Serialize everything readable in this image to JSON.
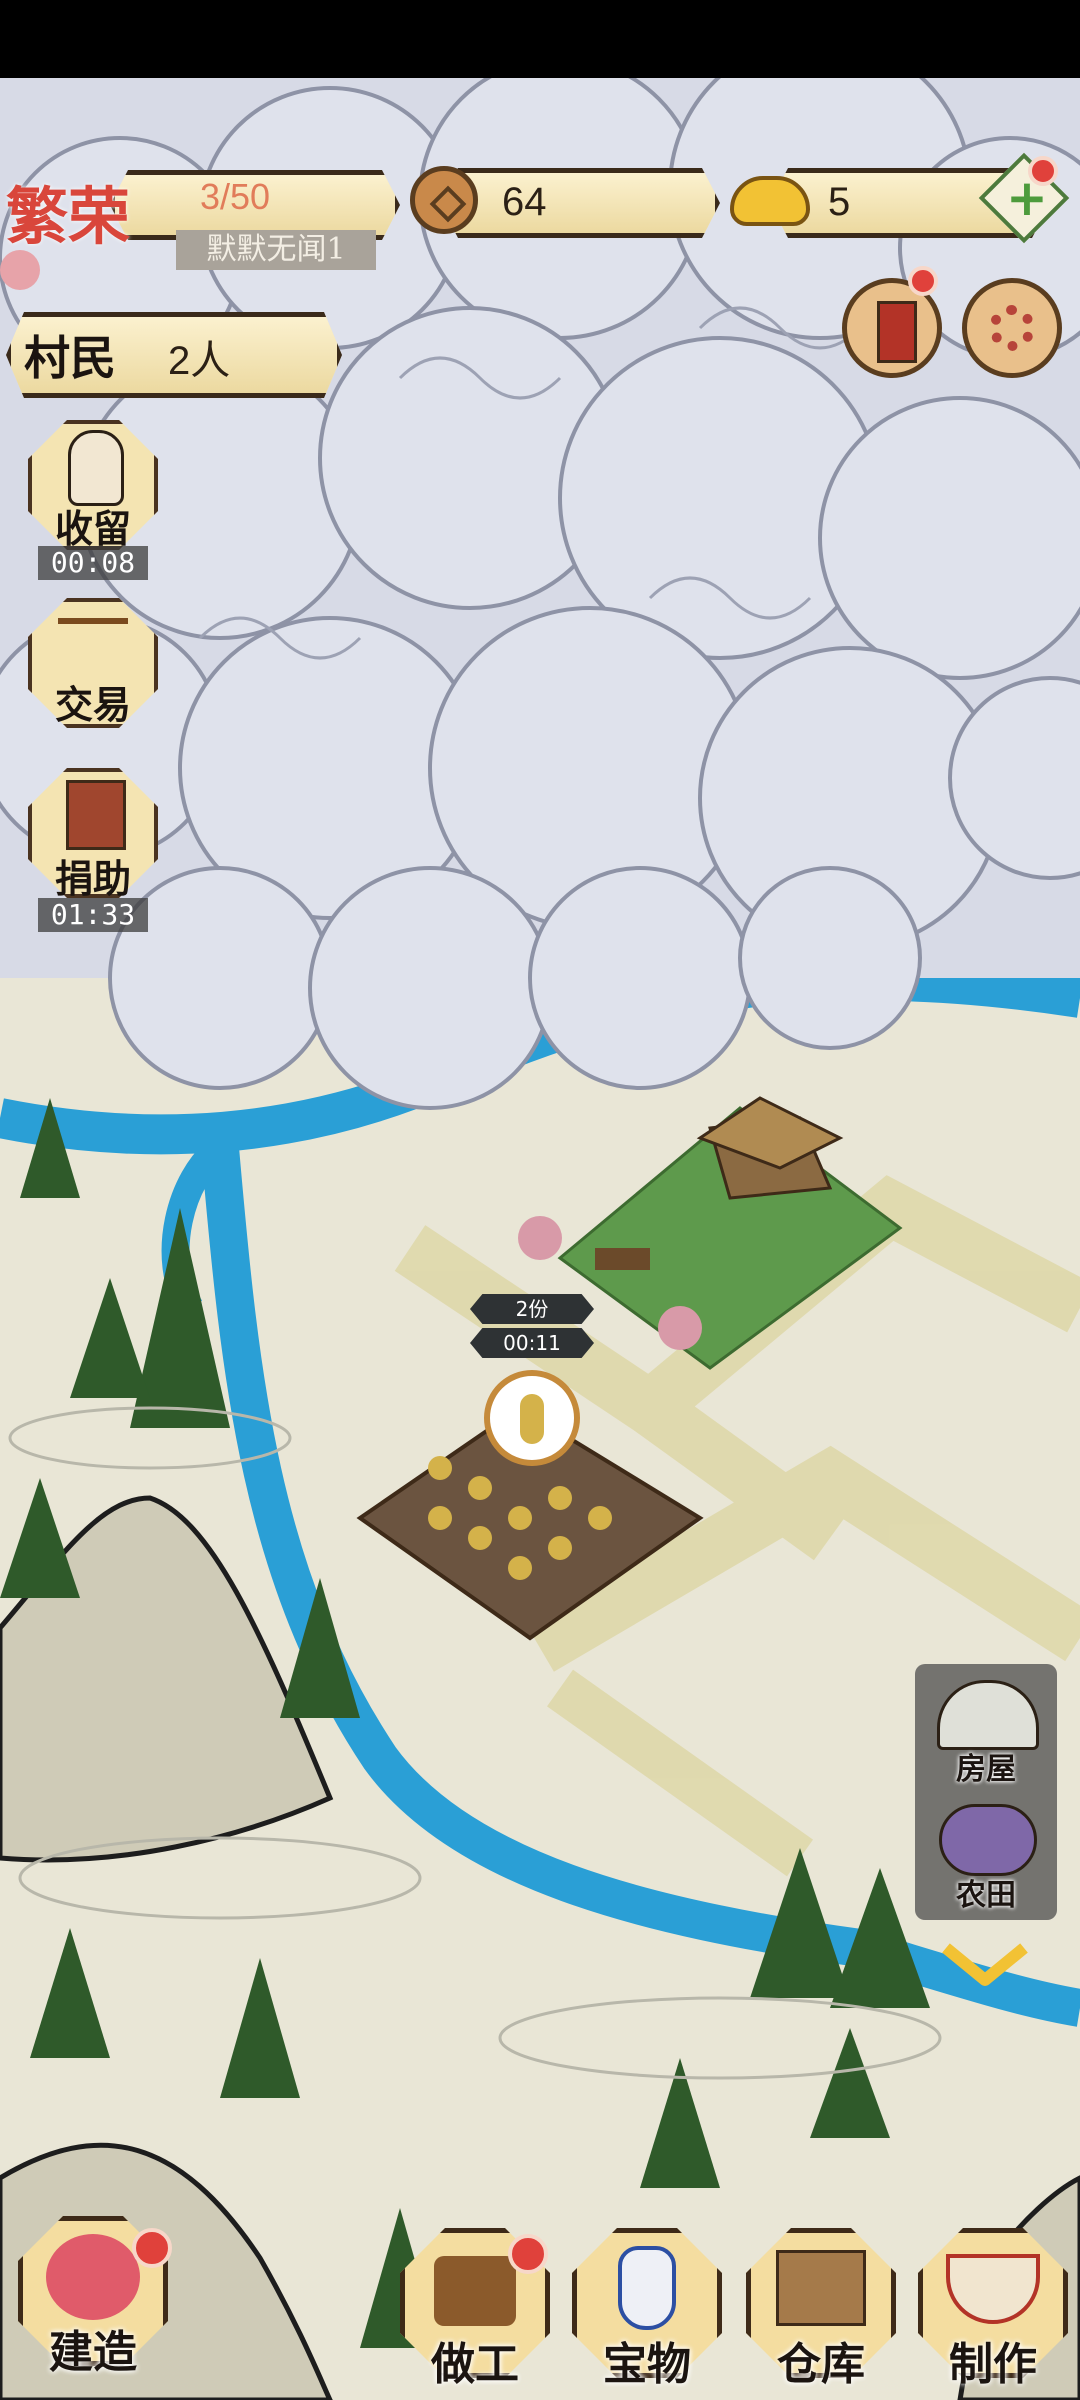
{
  "hud": {
    "prosperity_label": "繁荣",
    "prosperity_value": "3/50",
    "village_name": "默默无闻1",
    "coins": "64",
    "gold": "5",
    "villagers_label": "村民",
    "villagers_count": "2人"
  },
  "side_buttons": [
    {
      "label": "收留",
      "timer": "00:08",
      "icon": "villager-portrait-icon"
    },
    {
      "label": "交易",
      "timer": "",
      "icon": "scale-icon"
    },
    {
      "label": "捐助",
      "timer": "01:33",
      "icon": "donation-box-icon"
    }
  ],
  "top_right": {
    "letter_icon": "official-letter-icon",
    "settings_icon": "gear-icon"
  },
  "field_tags": {
    "portions": "2份",
    "timer": "00:11"
  },
  "build_panel": {
    "items": [
      {
        "label": "房屋",
        "icon": "house-icon"
      },
      {
        "label": "农田",
        "icon": "farmland-icon"
      }
    ]
  },
  "bottom_bar": [
    {
      "label": "建造",
      "icon": "build-icon"
    },
    {
      "label": "做工",
      "icon": "work-icon"
    },
    {
      "label": "宝物",
      "icon": "vase-icon"
    },
    {
      "label": "仓库",
      "icon": "warehouse-icon"
    },
    {
      "label": "制作",
      "icon": "cooking-icon"
    }
  ],
  "colors": {
    "river": "#2a9fd6",
    "cloud": "#d7dae6",
    "ground": "#e9e6d6",
    "grass": "#5e9a4c",
    "soil": "#6b5440",
    "accent_red": "#e0413b"
  }
}
